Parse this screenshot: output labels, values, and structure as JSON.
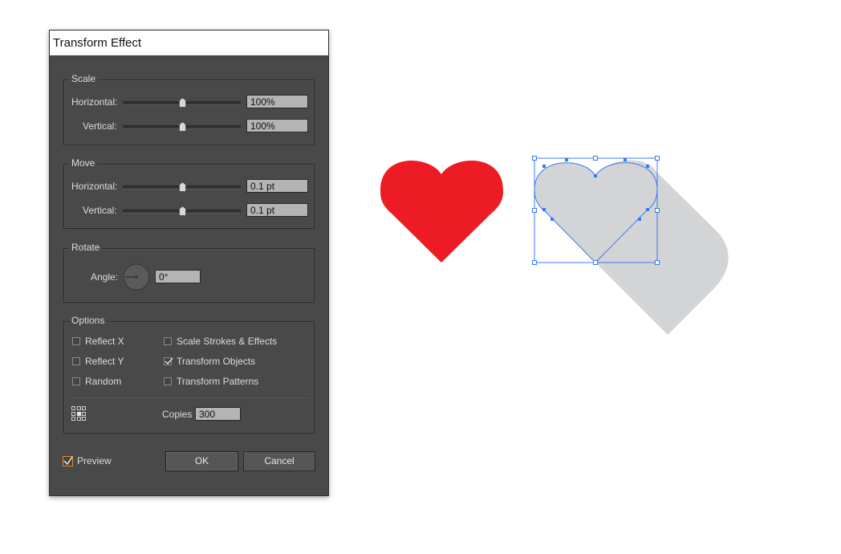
{
  "dialog": {
    "title": "Transform Effect",
    "scale": {
      "title": "Scale",
      "horizontal_label": "Horizontal:",
      "horizontal_value": "100%",
      "vertical_label": "Vertical:",
      "vertical_value": "100%"
    },
    "move": {
      "title": "Move",
      "horizontal_label": "Horizontal:",
      "horizontal_value": "0.1 pt",
      "vertical_label": "Vertical:",
      "vertical_value": "0.1 pt"
    },
    "rotate": {
      "title": "Rotate",
      "angle_label": "Angle:",
      "angle_value": "0°"
    },
    "options": {
      "title": "Options",
      "reflect_x": {
        "label": "Reflect X",
        "checked": false
      },
      "reflect_y": {
        "label": "Reflect Y",
        "checked": false
      },
      "random": {
        "label": "Random",
        "checked": false
      },
      "scale_strokes": {
        "label": "Scale Strokes & Effects",
        "checked": false
      },
      "transform_objects": {
        "label": "Transform Objects",
        "checked": true
      },
      "transform_patterns": {
        "label": "Transform Patterns",
        "checked": false
      },
      "copies_label": "Copies",
      "copies_value": "300"
    },
    "preview": {
      "label": "Preview",
      "checked": true
    },
    "ok_label": "OK",
    "cancel_label": "Cancel"
  },
  "canvas": {
    "heart_color": "#ed1c24",
    "ghost_color": "#d3d4d6",
    "selection_color": "#3c78f0"
  }
}
